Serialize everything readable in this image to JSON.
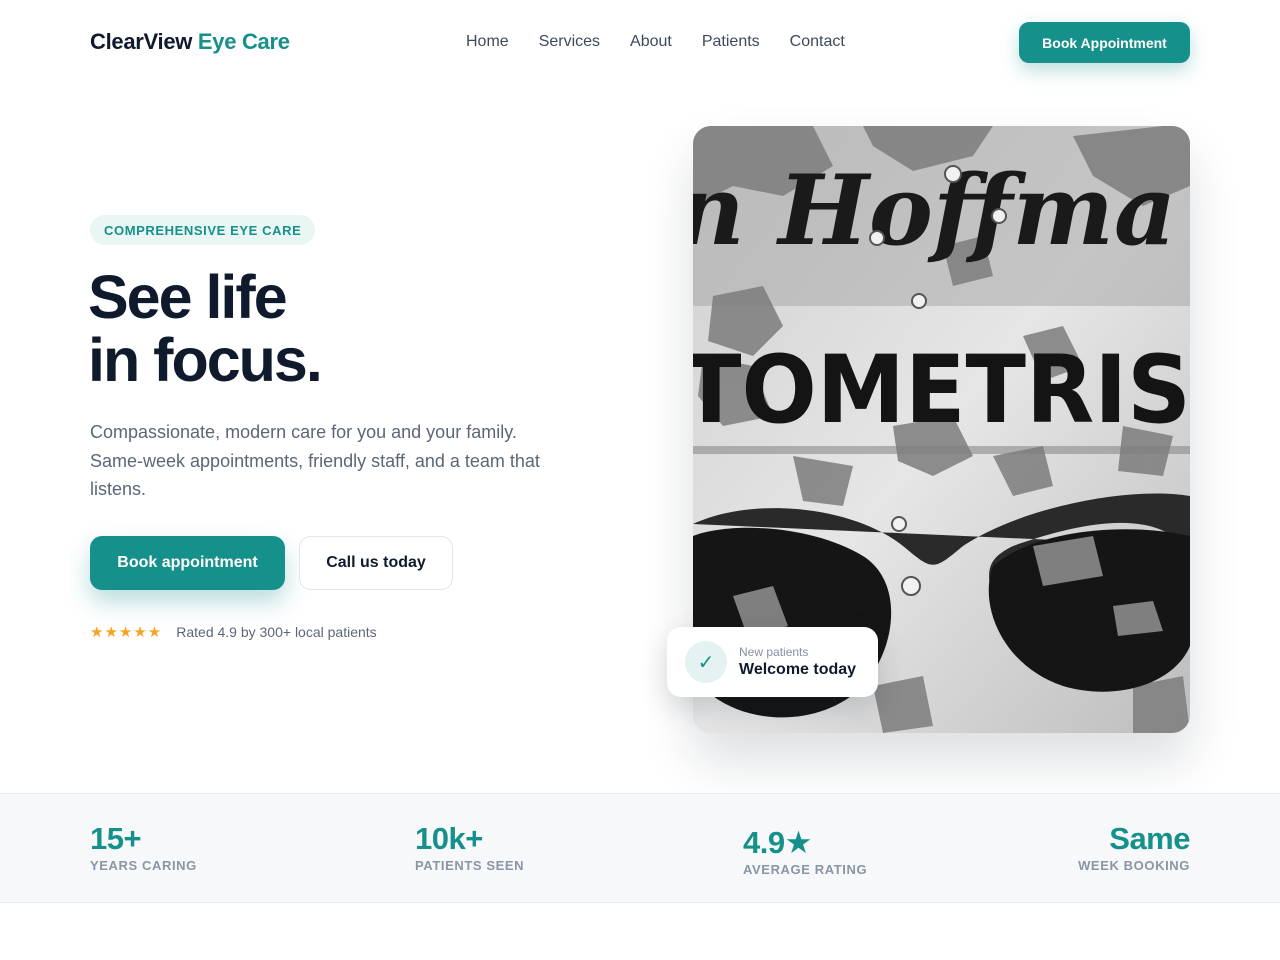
{
  "brand": {
    "name_part1": "ClearView",
    "name_part2": "Eye Care"
  },
  "nav": {
    "links": [
      "Home",
      "Services",
      "About",
      "Patients",
      "Contact"
    ],
    "cta_label": "Book Appointment"
  },
  "hero": {
    "eyebrow": "COMPREHENSIVE EYE CARE",
    "headline_line1": "See life",
    "headline_line2": "in focus.",
    "lede": "Compassionate, modern care for you and your family. Same-week appointments, friendly staff, and a team that listens.",
    "primary_button": "Book appointment",
    "secondary_button": "Call us today",
    "stars": "★★★★★",
    "rating_text": "Rated 4.9 by 300+ local patients"
  },
  "photo": {
    "sign_line1": "n Hoffma",
    "sign_line2": "TOMETRIS"
  },
  "welcome_card": {
    "small": "New patients",
    "big": "Welcome today",
    "icon": "check-icon"
  },
  "stats": [
    {
      "value": "15+",
      "label": "YEARS CARING"
    },
    {
      "value": "10k+",
      "label": "PATIENTS SEEN"
    },
    {
      "value": "4.9★",
      "label": "AVERAGE RATING"
    },
    {
      "value": "Same",
      "label": "WEEK BOOKING"
    }
  ],
  "colors": {
    "accent": "#16908a",
    "text_dark": "#0f1b2d",
    "muted": "#5b6678",
    "star": "#f5a524"
  }
}
